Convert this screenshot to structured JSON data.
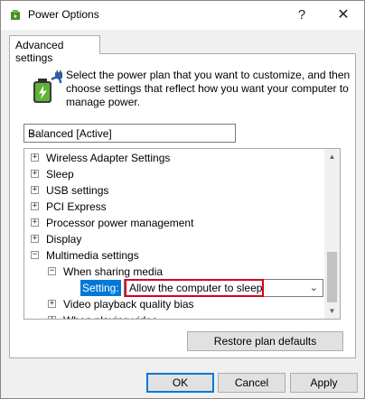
{
  "window": {
    "title": "Power Options",
    "help_glyph": "?",
    "close_glyph": "✕"
  },
  "tab": {
    "label": "Advanced settings"
  },
  "intro_text": "Select the power plan that you want to customize, and then choose settings that reflect how you want your computer to manage power.",
  "plan_select": {
    "value": "Balanced [Active]"
  },
  "tree": {
    "items": [
      {
        "label": "Wireless Adapter Settings",
        "expander": "+"
      },
      {
        "label": "Sleep",
        "expander": "+"
      },
      {
        "label": "USB settings",
        "expander": "+"
      },
      {
        "label": "PCI Express",
        "expander": "+"
      },
      {
        "label": "Processor power management",
        "expander": "+"
      },
      {
        "label": "Display",
        "expander": "+"
      },
      {
        "label": "Multimedia settings",
        "expander": "−"
      },
      {
        "label": "When sharing media",
        "expander": "−"
      },
      {
        "label": "Video playback quality bias",
        "expander": "+"
      },
      {
        "label": "When playing video",
        "expander": "+"
      }
    ],
    "setting_label": "Setting:",
    "setting_value": "Allow the computer to sleep"
  },
  "buttons": {
    "restore": "Restore plan defaults",
    "ok": "OK",
    "cancel": "Cancel",
    "apply": "Apply"
  },
  "icons": {
    "app": "power-options-icon",
    "plan": "battery-plug-icon",
    "dropdown": "chevron-down-icon"
  },
  "colors": {
    "selection": "#0078d7",
    "highlight_border": "#d6001c",
    "default_button_border": "#0078d7"
  }
}
